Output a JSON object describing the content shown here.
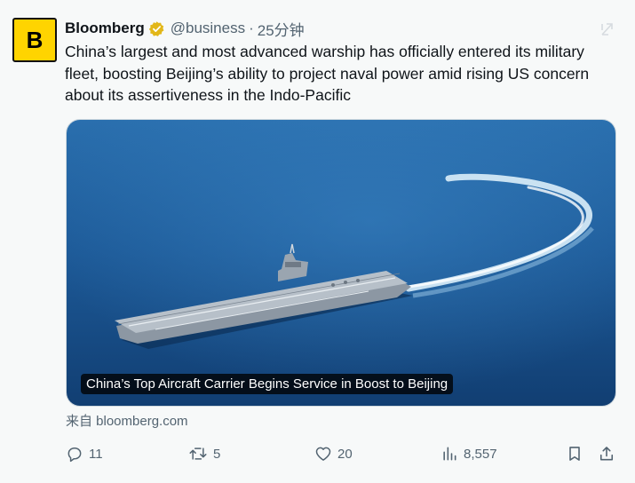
{
  "tweet": {
    "avatar_letter": "B",
    "name": "Bloomberg",
    "handle": "@business",
    "separator": "·",
    "time": "25分钟",
    "text": "China’s largest and most advanced warship has officially entered its military fleet, boosting Beijing’s ability to project naval power amid rising US concern about its assertiveness in the Indo-Pacific",
    "media": {
      "caption": "China’s Top Aircraft Carrier Begins Service in Boost to Beijing"
    },
    "source": "来自 bloomberg.com"
  },
  "actions": {
    "reply": {
      "icon": "reply-icon",
      "count": "11"
    },
    "repost": {
      "icon": "repost-icon",
      "count": "5"
    },
    "like": {
      "icon": "heart-icon",
      "count": "20"
    },
    "views": {
      "icon": "views-icon",
      "count": "8,557"
    },
    "bookmark": {
      "icon": "bookmark-icon"
    },
    "share": {
      "icon": "share-icon"
    }
  },
  "colors": {
    "background": "#f7f9f9",
    "text": "#0f1419",
    "secondary_text": "#536471",
    "verified_gold": "#e2b719",
    "bloomberg_yellow": "#ffd400",
    "sea": "#1a4f86"
  }
}
